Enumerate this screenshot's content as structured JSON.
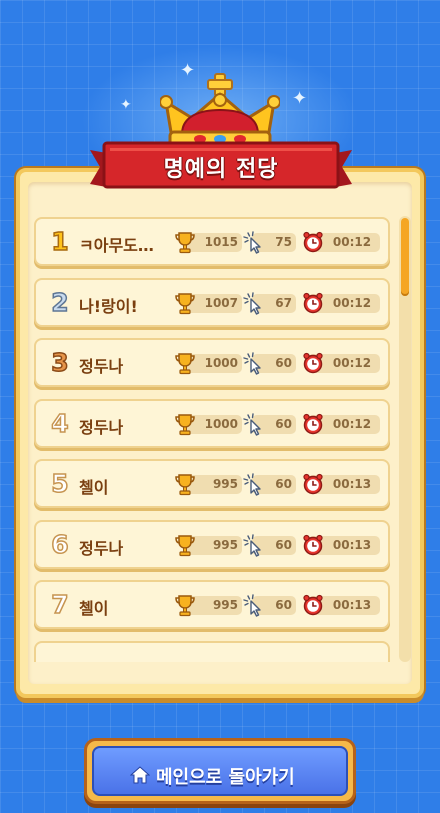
{
  "screen": {
    "title": "명예의 전당"
  },
  "leaderboard": [
    {
      "rank": "1",
      "rank_style": "gold",
      "name": "ㅋ아무도…",
      "score": "1015",
      "clicks": "75",
      "time": "00:12"
    },
    {
      "rank": "2",
      "rank_style": "silver",
      "name": "나!랑이!",
      "score": "1007",
      "clicks": "67",
      "time": "00:12"
    },
    {
      "rank": "3",
      "rank_style": "bronze",
      "name": "정두나",
      "score": "1000",
      "clicks": "60",
      "time": "00:12"
    },
    {
      "rank": "4",
      "rank_style": "plain",
      "name": "정두나",
      "score": "1000",
      "clicks": "60",
      "time": "00:12"
    },
    {
      "rank": "5",
      "rank_style": "plain",
      "name": "첼이",
      "score": "995",
      "clicks": "60",
      "time": "00:13"
    },
    {
      "rank": "6",
      "rank_style": "plain",
      "name": "정두나",
      "score": "995",
      "clicks": "60",
      "time": "00:13"
    },
    {
      "rank": "7",
      "rank_style": "plain",
      "name": "첼이",
      "score": "995",
      "clicks": "60",
      "time": "00:13"
    }
  ],
  "icons": {
    "score": "trophy-icon",
    "clicks": "cursor-click-icon",
    "time": "alarm-clock-icon",
    "home": "home-icon",
    "crown": "crown-icon"
  },
  "footer": {
    "home_button_label": "메인으로 돌아가기"
  },
  "colors": {
    "background": "#2f7ee8",
    "panel": "#fde9a8",
    "banner": "#d6262a",
    "button": "#4a72e8",
    "accent": "#f5a623"
  }
}
